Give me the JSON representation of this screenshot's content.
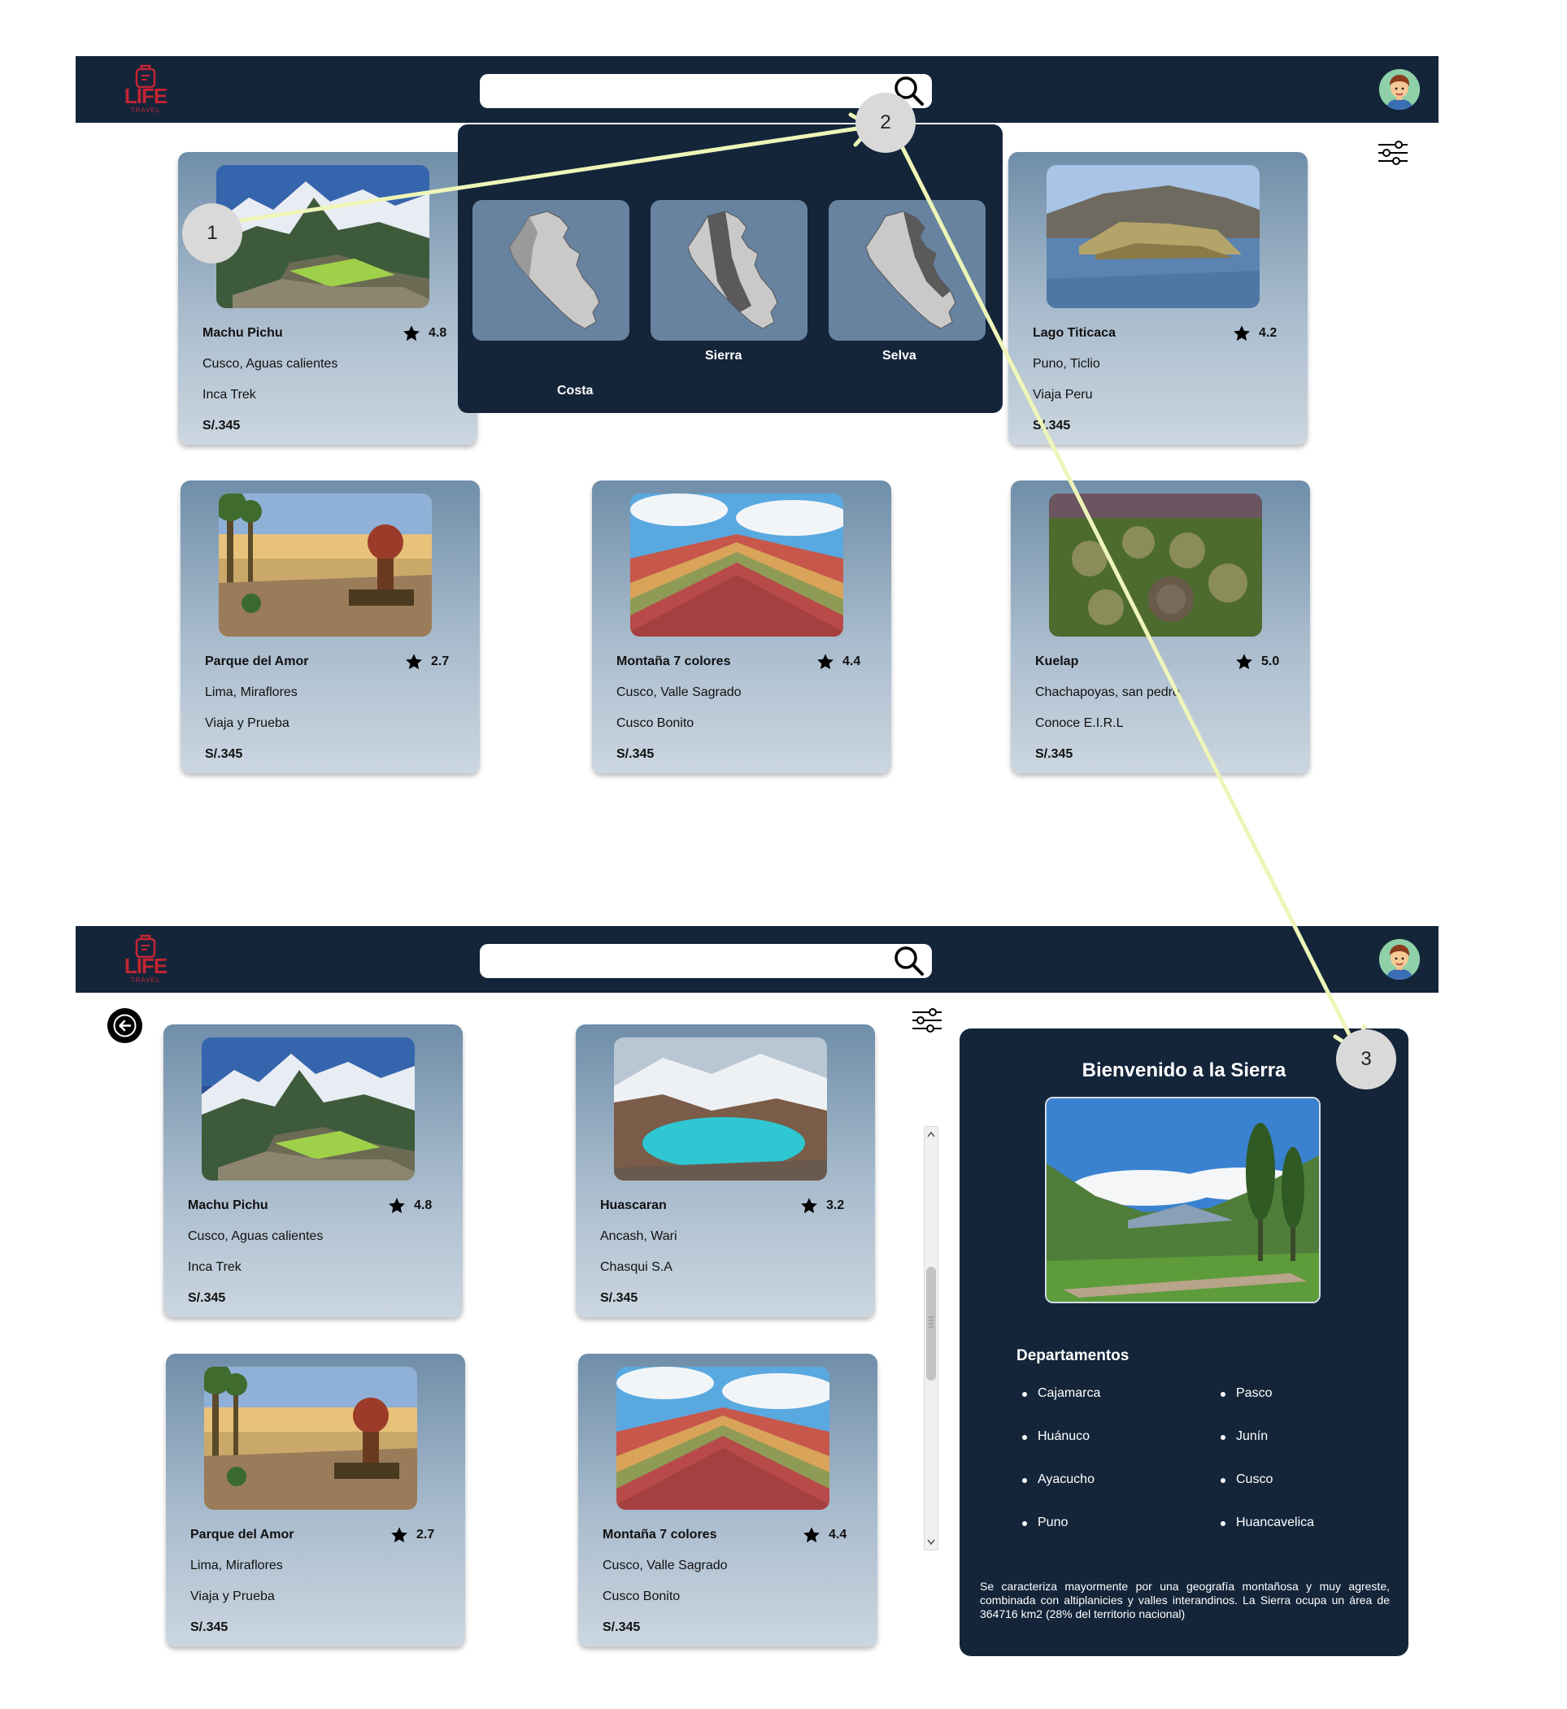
{
  "brand": {
    "logo_text": "LIFE",
    "logo_sub": "TRAVEL"
  },
  "search": {
    "value": "",
    "placeholder": ""
  },
  "steps": [
    "1",
    "2",
    "3"
  ],
  "regions": [
    {
      "name": "Costa"
    },
    {
      "name": "Sierra"
    },
    {
      "name": "Selva"
    }
  ],
  "screen1": {
    "cards": [
      {
        "title": "Machu Pichu",
        "rating": "4.8",
        "location": "Cusco, Aguas calientes",
        "agency": "Inca Trek",
        "price": "S/.345",
        "photo": "machu-picchu"
      },
      {
        "title": "Lago Titicaca",
        "rating": "4.2",
        "location": "Puno, Ticlio",
        "agency": "Viaja Peru",
        "price": "S/.345",
        "photo": "titicaca"
      },
      {
        "title": "Parque del Amor",
        "rating": "2.7",
        "location": "Lima, Miraflores",
        "agency": "Viaja y Prueba",
        "price": "S/.345",
        "photo": "parque-amor"
      },
      {
        "title": "Montaña 7 colores",
        "rating": "4.4",
        "location": "Cusco, Valle Sagrado",
        "agency": "Cusco Bonito",
        "price": "S/.345",
        "photo": "rainbow-mountain"
      },
      {
        "title": "Kuelap",
        "rating": "5.0",
        "location": "Chachapoyas, san pedro",
        "agency": "Conoce E.I.R.L",
        "price": "S/.345",
        "photo": "kuelap"
      }
    ]
  },
  "screen2": {
    "cards": [
      {
        "title": "Machu Pichu",
        "rating": "4.8",
        "location": "Cusco, Aguas calientes",
        "agency": "Inca Trek",
        "price": "S/.345",
        "photo": "machu-picchu"
      },
      {
        "title": "Huascaran",
        "rating": "3.2",
        "location": "Ancash, Wari",
        "agency": "Chasqui S.A",
        "price": "S/.345",
        "photo": "huascaran"
      },
      {
        "title": "Parque del Amor",
        "rating": "2.7",
        "location": "Lima, Miraflores",
        "agency": "Viaja y Prueba",
        "price": "S/.345",
        "photo": "parque-amor"
      },
      {
        "title": "Montaña 7 colores",
        "rating": "4.4",
        "location": "Cusco, Valle Sagrado",
        "agency": "Cusco Bonito",
        "price": "S/.345",
        "photo": "rainbow-mountain"
      }
    ],
    "sierra": {
      "title": "Bienvenido a la Sierra",
      "departments_title": "Departamentos",
      "departments": [
        "Cajamarca",
        "Pasco",
        "Huánuco",
        "Junín",
        "Ayacucho",
        "Cusco",
        "Puno",
        "Huancavelica"
      ],
      "description": "Se caracteriza mayormente por una geografía montañosa y muy agreste, combinada con altiplanicies y valles interandinos. La Sierra ocupa un área de 364716 km2 (28% del territorio nacional)"
    }
  },
  "icons": {
    "search": "search-icon",
    "filter": "sliders-icon",
    "star": "star-icon",
    "back": "arrow-left-icon",
    "avatar": "user-avatar"
  },
  "colors": {
    "navbar": "#14253a",
    "brand": "#c42532",
    "arrow": "#eef5b8",
    "card_top": "#6f8ea9",
    "card_bottom": "#cbd6e0"
  }
}
